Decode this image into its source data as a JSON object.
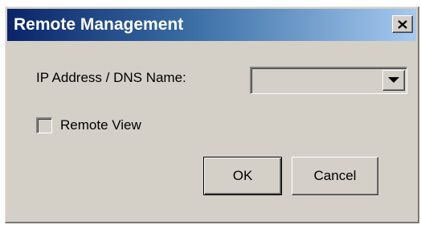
{
  "window": {
    "title": "Remote Management",
    "close_icon": "close-icon"
  },
  "form": {
    "ip_label": "IP Address / DNS Name:",
    "ip_value": "",
    "dropdown_icon": "chevron-down-icon",
    "remote_view_label": "Remote View",
    "remote_view_checked": false
  },
  "buttons": {
    "ok_label": "OK",
    "cancel_label": "Cancel"
  },
  "colors": {
    "titlebar_start": "#0a246a",
    "titlebar_end": "#a6caf0",
    "face": "#d4d0c8"
  }
}
